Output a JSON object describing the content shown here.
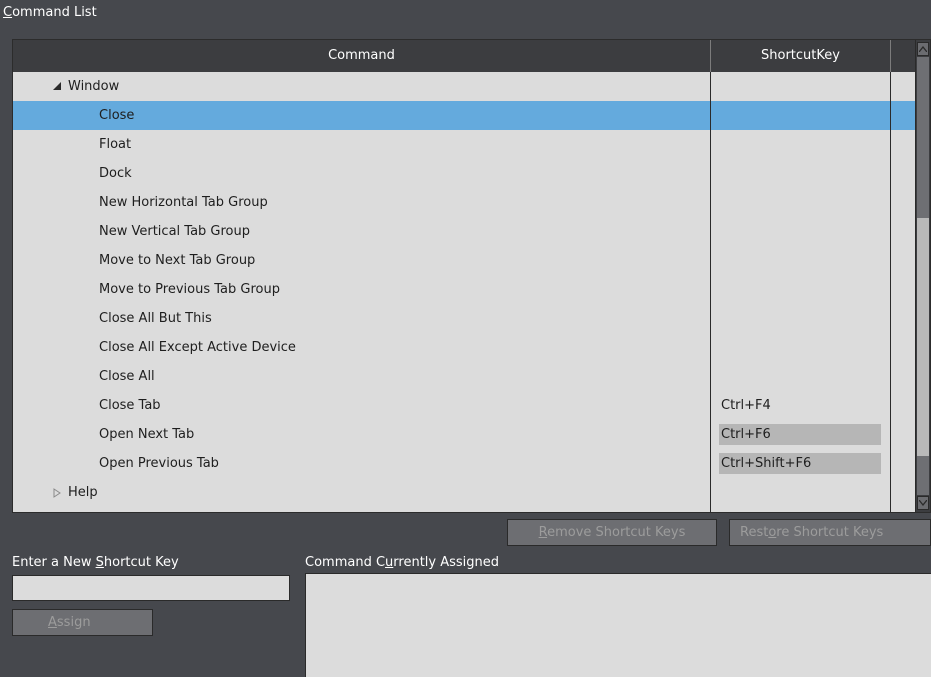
{
  "panel": {
    "title_prefix": "C",
    "title_rest": "ommand List"
  },
  "grid": {
    "columns": {
      "command": "Command",
      "shortcut": "ShortcutKey"
    },
    "rows": [
      {
        "label": "Window",
        "shortcut": "",
        "level": 1,
        "expander": "expanded",
        "selected": false,
        "editable": false
      },
      {
        "label": "Close",
        "shortcut": "",
        "level": 2,
        "expander": "",
        "selected": true,
        "editable": false
      },
      {
        "label": "Float",
        "shortcut": "",
        "level": 2,
        "expander": "",
        "selected": false,
        "editable": false
      },
      {
        "label": "Dock",
        "shortcut": "",
        "level": 2,
        "expander": "",
        "selected": false,
        "editable": false
      },
      {
        "label": "New Horizontal Tab Group",
        "shortcut": "",
        "level": 2,
        "expander": "",
        "selected": false,
        "editable": false
      },
      {
        "label": "New Vertical Tab Group",
        "shortcut": "",
        "level": 2,
        "expander": "",
        "selected": false,
        "editable": false
      },
      {
        "label": "Move to Next Tab Group",
        "shortcut": "",
        "level": 2,
        "expander": "",
        "selected": false,
        "editable": false
      },
      {
        "label": "Move to Previous Tab Group",
        "shortcut": "",
        "level": 2,
        "expander": "",
        "selected": false,
        "editable": false
      },
      {
        "label": "Close All But This",
        "shortcut": "",
        "level": 2,
        "expander": "",
        "selected": false,
        "editable": false
      },
      {
        "label": "Close All Except Active Device",
        "shortcut": "",
        "level": 2,
        "expander": "",
        "selected": false,
        "editable": false
      },
      {
        "label": "Close All",
        "shortcut": "",
        "level": 2,
        "expander": "",
        "selected": false,
        "editable": false
      },
      {
        "label": "Close Tab",
        "shortcut": "Ctrl+F4",
        "level": 2,
        "expander": "",
        "selected": false,
        "editable": false
      },
      {
        "label": "Open Next Tab",
        "shortcut": "Ctrl+F6",
        "level": 2,
        "expander": "",
        "selected": false,
        "editable": true
      },
      {
        "label": "Open Previous Tab",
        "shortcut": "Ctrl+Shift+F6",
        "level": 2,
        "expander": "",
        "selected": false,
        "editable": true
      },
      {
        "label": "Help",
        "shortcut": "",
        "level": 1,
        "expander": "collapsed",
        "selected": false,
        "editable": false
      }
    ]
  },
  "buttons": {
    "remove_prefix": "",
    "remove_accel": "R",
    "remove_rest": "emove Shortcut Keys",
    "restore_prefix": "Rest",
    "restore_accel": "o",
    "restore_rest": "re Shortcut Keys",
    "assign_accel": "A",
    "assign_rest": "ssign"
  },
  "new_key": {
    "label_prefix": "Enter a New ",
    "label_accel": "S",
    "label_rest": "hortcut Key",
    "value": "",
    "placeholder": ""
  },
  "assigned": {
    "label_prefix": "Command C",
    "label_accel": "u",
    "label_rest": "rrently Assigned"
  },
  "icons": {
    "expanded": "triangle-down-right-icon",
    "collapsed": "triangle-right-outline-icon",
    "scroll_up": "chevron-up-icon",
    "scroll_down": "chevron-down-icon"
  },
  "colors": {
    "selection": "#64aadd",
    "background": "#46484d",
    "grid": "#dcdcdc"
  }
}
